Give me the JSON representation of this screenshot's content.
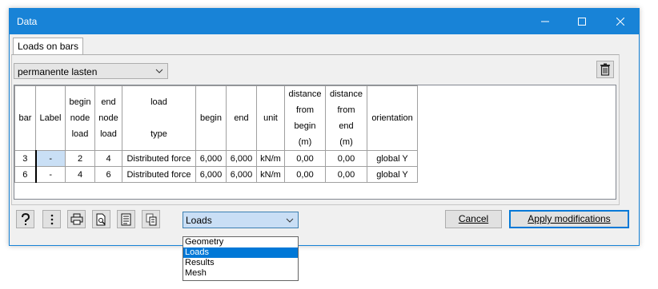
{
  "window": {
    "title": "Data"
  },
  "tabs": [
    {
      "label": "Loads on bars"
    }
  ],
  "load_case": {
    "value": "permanente lasten"
  },
  "table": {
    "headers": [
      {
        "lines": [
          "bar"
        ]
      },
      {
        "lines": [
          "Label"
        ]
      },
      {
        "lines": [
          "begin",
          "node",
          "load"
        ]
      },
      {
        "lines": [
          "end",
          "node",
          "load"
        ]
      },
      {
        "lines": [
          "load",
          "",
          "type"
        ]
      },
      {
        "lines": [
          "begin"
        ]
      },
      {
        "lines": [
          "end"
        ]
      },
      {
        "lines": [
          "unit"
        ]
      },
      {
        "lines": [
          "distance",
          "from",
          "begin",
          "(m)"
        ]
      },
      {
        "lines": [
          "distance",
          "from",
          "end",
          "(m)"
        ]
      },
      {
        "lines": [
          "orientation"
        ]
      }
    ],
    "rows": [
      [
        "3",
        "-",
        "2",
        "4",
        "Distributed force",
        "6,000",
        "6,000",
        "kN/m",
        "0,00",
        "0,00",
        "global Y"
      ],
      [
        "6",
        "-",
        "4",
        "6",
        "Distributed force",
        "6,000",
        "6,000",
        "kN/m",
        "0,00",
        "0,00",
        "global Y"
      ]
    ]
  },
  "view_select": {
    "value": "Loads",
    "options": [
      "Geometry",
      "Loads",
      "Results",
      "Mesh"
    ],
    "highlighted": "Loads"
  },
  "buttons": {
    "cancel": "Cancel",
    "apply": "Apply modifications"
  },
  "icons": [
    "help-icon",
    "more-icon",
    "print-icon",
    "print-preview-icon",
    "report-icon",
    "copy-icon",
    "trash-icon"
  ],
  "colors": {
    "titlebar": "#1883d7",
    "selection": "#0078d7"
  }
}
